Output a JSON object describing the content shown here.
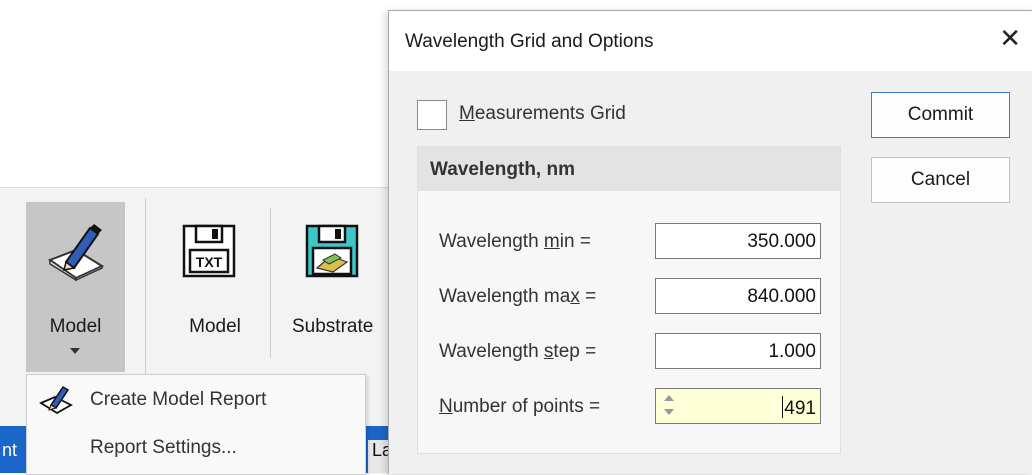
{
  "ribbon": {
    "model_dropdown_label": "Model",
    "model_txt_label": "Model",
    "substrate_label": "Substrate",
    "txt_icon_text": "TXT"
  },
  "menu": {
    "items": [
      {
        "label": "Create Model Report",
        "icon": "report-pen-icon"
      },
      {
        "label": "Report Settings...",
        "icon": ""
      }
    ]
  },
  "statusbar": {
    "left_text": "nt",
    "right_text": "La"
  },
  "dialog": {
    "title": "Wavelength Grid and Options",
    "close_glyph": "✕",
    "measurements_grid": {
      "label_pre": "",
      "label_mnemonic": "M",
      "label_post": "easurements Grid",
      "checked": false
    },
    "group_title": "Wavelength, nm",
    "fields": [
      {
        "label_pre": "Wavelength ",
        "mnemonic": "m",
        "label_post": "in =",
        "value": "350.000"
      },
      {
        "label_pre": "Wavelength ma",
        "mnemonic": "x",
        "label_post": " =",
        "value": "840.000"
      },
      {
        "label_pre": "Wavelength ",
        "mnemonic": "s",
        "label_post": "tep =",
        "value": "1.000"
      },
      {
        "label_pre": "",
        "mnemonic": "N",
        "label_post": "umber of points =",
        "value": "491"
      }
    ],
    "buttons": {
      "commit": "Commit",
      "cancel": "Cancel"
    }
  },
  "colors": {
    "statusbar": "#1a66c9",
    "active_field": "#ffffd8",
    "primary_button_border": "#3b7fd0",
    "floppy_teal": "#3cc8c8"
  }
}
